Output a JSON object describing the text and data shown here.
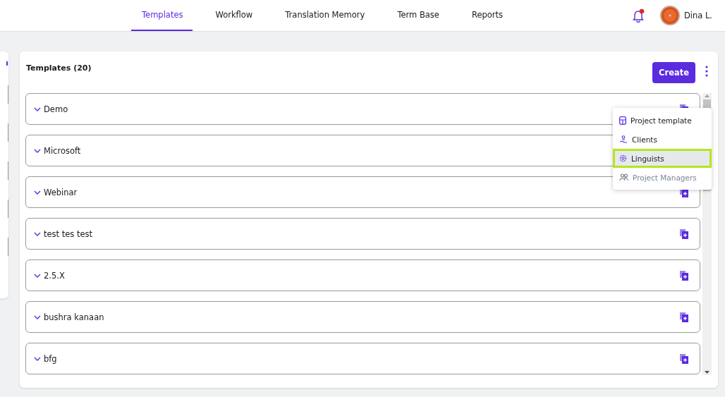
{
  "nav": {
    "tabs": [
      {
        "label": "Templates",
        "selected": true
      },
      {
        "label": "Workflow",
        "selected": false
      },
      {
        "label": "Translation Memory",
        "selected": false
      },
      {
        "label": "Term Base",
        "selected": false
      },
      {
        "label": "Reports",
        "selected": false
      }
    ],
    "notifications": {
      "unread": true
    },
    "user": {
      "name": "Dina L."
    }
  },
  "templates": {
    "title": "Templates (20)",
    "create_button": "Create",
    "items": [
      {
        "name": "Demo"
      },
      {
        "name": "Microsoft"
      },
      {
        "name": "Webinar"
      },
      {
        "name": "test tes test"
      },
      {
        "name": "2.5.X"
      },
      {
        "name": "bushra kanaan"
      },
      {
        "name": "bfg"
      }
    ]
  },
  "menu": {
    "items": [
      {
        "kind": "template",
        "label": "Project template",
        "selected": false,
        "disabled": false
      },
      {
        "kind": "client",
        "label": "Clients",
        "selected": false,
        "disabled": false
      },
      {
        "kind": "linguist",
        "label": "Linguists",
        "selected": true,
        "disabled": false
      },
      {
        "kind": "managers",
        "label": "Project Managers",
        "selected": false,
        "disabled": true
      }
    ]
  }
}
